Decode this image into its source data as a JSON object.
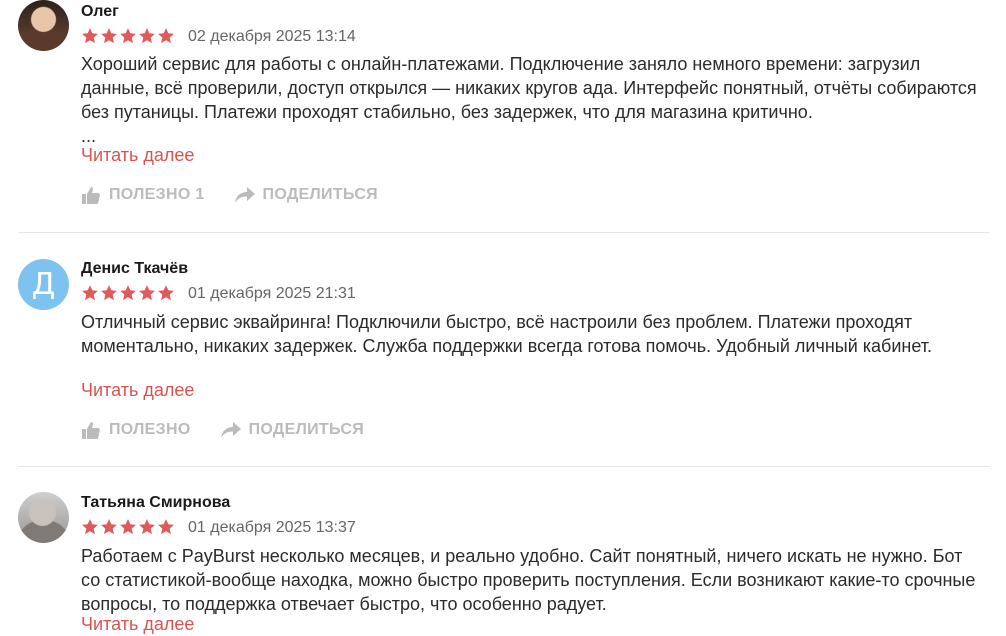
{
  "colors": {
    "star": "#e05a5a",
    "link": "#d9534f",
    "action": "#bbbbbb",
    "avatar_letter_bg": "#7ec3f0"
  },
  "reviews": [
    {
      "author": "Олег",
      "rating": 5,
      "date": "02 декабря 2025 13:14",
      "text": "Хороший сервис для работы с онлайн-платежами. Подключение заняло немного времени: загрузил данные, всё проверили, доступ открылся — никаких кругов ада. Интерфейс понятный, отчёты собираются без путаницы. Платежи проходят стабильно, без задержек, что для магазина критично.\n...",
      "read_more": "Читать далее",
      "like_label": "ПОЛЕЗНО 1",
      "share_label": "ПОДЕЛИТЬСЯ",
      "avatar_icon": "user-photo"
    },
    {
      "author": "Денис Ткачёв",
      "rating": 5,
      "date": "01 декабря 2025 21:31",
      "text": "Отличный сервис эквайринга! Подключили быстро, всё настроили без проблем. Платежи проходят моментально, никаких задержек. Служба поддержки всегда готова помочь. Удобный личный кабинет.",
      "read_more": "Читать далее",
      "like_label": "ПОЛЕЗНО",
      "share_label": "ПОДЕЛИТЬСЯ",
      "avatar_letter": "Д"
    },
    {
      "author": "Татьяна Смирнова",
      "rating": 5,
      "date": "01 декабря 2025 13:37",
      "text": "Работаем с PayBurst несколько месяцев, и реально удобно. Сайт понятный, ничего искать не нужно. Бот со статистикой-вообще находка, можно быстро проверить поступления. Если возникают какие-то срочные вопросы, то поддержка отвечает быстро, что особенно радует.",
      "read_more": "Читать далее",
      "avatar_icon": "user-photo"
    }
  ]
}
